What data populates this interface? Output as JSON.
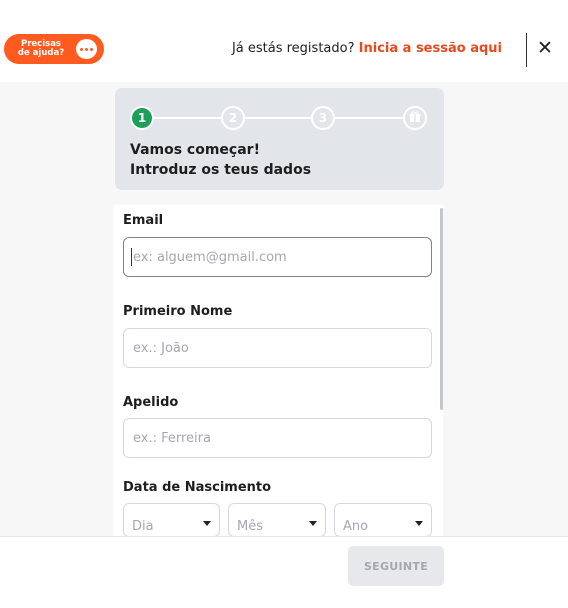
{
  "header": {
    "help_label": "Precisas de ajuda?",
    "login_prompt": "Já estás registado?",
    "login_link": "Inicia a sessão aqui",
    "close_symbol": "✕"
  },
  "stepper": {
    "steps": [
      "1",
      "2",
      "3"
    ],
    "final_step_icon": "gift-icon",
    "active_step": 1,
    "heading_line1": "Vamos começar!",
    "heading_line2": "Introduz os teus dados"
  },
  "form": {
    "email": {
      "label": "Email",
      "placeholder": "ex: alguem@gmail.com",
      "value": ""
    },
    "first_name": {
      "label": "Primeiro Nome",
      "placeholder": "ex.: João",
      "value": ""
    },
    "last_name": {
      "label": "Apelido",
      "placeholder": "ex.: Ferreira",
      "value": ""
    },
    "birth_date": {
      "label": "Data de Nascimento",
      "day_placeholder": "Dia",
      "month_placeholder": "Mês",
      "year_placeholder": "Ano"
    }
  },
  "footer": {
    "next_label": "SEGUINTE",
    "next_enabled": false
  },
  "colors": {
    "brand_orange": "#ff5a1f",
    "link_orange": "#e8491d",
    "active_step_green": "#1fa05a",
    "stepper_bg": "#e2e5e9",
    "disabled_button_bg": "#e6e8eb"
  }
}
